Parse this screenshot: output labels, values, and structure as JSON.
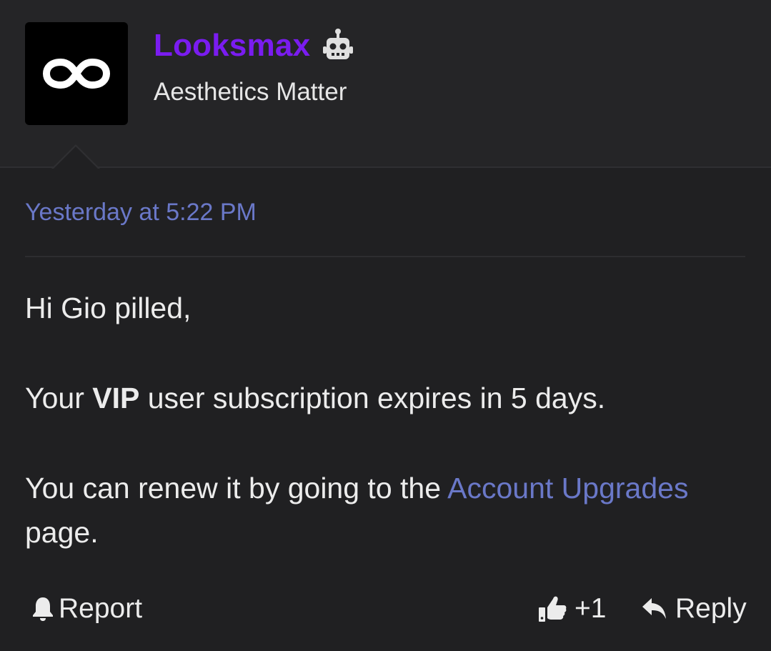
{
  "post": {
    "author": {
      "name": "Looksmax",
      "title": "Aesthetics Matter",
      "avatar_icon": "infinity-logo-icon",
      "badge_icon": "robot-icon",
      "name_color": "#7a1cf0"
    },
    "timestamp": "Yesterday at 5:22 PM",
    "body": {
      "greeting": "Hi Gio pilled,",
      "line2_prefix": "Your ",
      "line2_bold": "VIP",
      "line2_suffix": " user subscription expires in 5 days.",
      "line3_prefix": "You can renew it by going to the ",
      "line3_link": "Account Upgrades",
      "line3_suffix": " page."
    },
    "actions": {
      "report_label": "Report",
      "like_label": "+1",
      "reply_label": "Reply"
    },
    "colors": {
      "background": "#202022",
      "header_background": "#252527",
      "link": "#6a78c8",
      "text": "#ececec"
    }
  }
}
